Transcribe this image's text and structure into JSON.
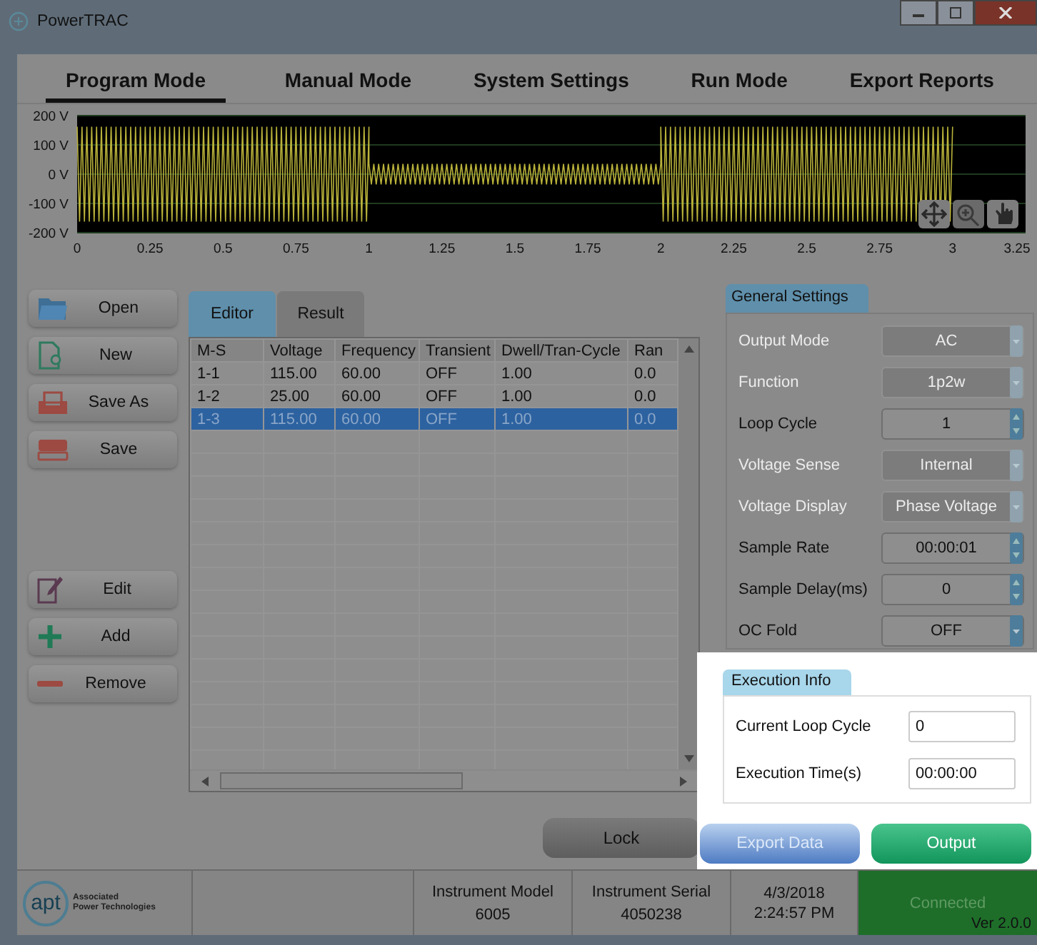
{
  "window": {
    "title": "PowerTRAC"
  },
  "tabs": [
    {
      "label": "Program Mode",
      "selected": true
    },
    {
      "label": "Manual Mode",
      "selected": false
    },
    {
      "label": "System Settings",
      "selected": false
    },
    {
      "label": "Run Mode",
      "selected": false
    },
    {
      "label": "Export Reports",
      "selected": false
    }
  ],
  "waveform": {
    "y_labels": [
      "200 V",
      "100 V",
      "0 V",
      "-100 V",
      "-200 V"
    ],
    "x_labels": [
      "0",
      "0.25",
      "0.5",
      "0.75",
      "1",
      "1.25",
      "1.5",
      "1.75",
      "2",
      "2.25",
      "2.5",
      "2.75",
      "3",
      "3.25"
    ]
  },
  "file_buttons": [
    "Open",
    "New",
    "Save As",
    "Save"
  ],
  "step_buttons": [
    "Edit",
    "Add",
    "Remove"
  ],
  "table_tabs": [
    {
      "label": "Editor",
      "selected": true
    },
    {
      "label": "Result",
      "selected": false
    }
  ],
  "table": {
    "columns": [
      "M-S",
      "Voltage",
      "Frequency",
      "Transient",
      "Dwell/Tran-Cycle",
      "Ran"
    ],
    "rows": [
      {
        "cells": [
          "1-1",
          "115.00",
          "60.00",
          "OFF",
          "1.00",
          "0.0"
        ],
        "selected": false
      },
      {
        "cells": [
          "1-2",
          "25.00",
          "60.00",
          "OFF",
          "1.00",
          "0.0"
        ],
        "selected": false
      },
      {
        "cells": [
          "1-3",
          "115.00",
          "60.00",
          "OFF",
          "1.00",
          "0.0"
        ],
        "selected": true
      }
    ]
  },
  "lock_button": "Lock",
  "general_settings": {
    "title": "General Settings",
    "fields": [
      {
        "label": "Output Mode",
        "value": "AC",
        "kind": "dropdown",
        "disabled": true
      },
      {
        "label": "Function",
        "value": "1p2w",
        "kind": "dropdown",
        "disabled": true
      },
      {
        "label": "Loop Cycle",
        "value": "1",
        "kind": "spinner",
        "disabled": false
      },
      {
        "label": "Voltage Sense",
        "value": "Internal",
        "kind": "dropdown",
        "disabled": true
      },
      {
        "label": "Voltage Display",
        "value": "Phase Voltage",
        "kind": "dropdown",
        "disabled": true
      },
      {
        "label": "Sample Rate",
        "value": "00:00:01",
        "kind": "spinner",
        "disabled": false
      },
      {
        "label": "Sample Delay(ms)",
        "value": "0",
        "kind": "spinner",
        "disabled": false
      },
      {
        "label": "OC Fold",
        "value": "OFF",
        "kind": "dropdown",
        "disabled": false
      }
    ]
  },
  "execution_info": {
    "title": "Execution Info",
    "fields": [
      {
        "label": "Current Loop Cycle",
        "value": "0"
      },
      {
        "label": "Execution Time(s)",
        "value": "00:00:00"
      }
    ]
  },
  "action_buttons": [
    {
      "label": "Export Data",
      "kind": "export",
      "disabled": true
    },
    {
      "label": "Output",
      "kind": "output",
      "disabled": false
    }
  ],
  "status_bar": {
    "logo_mark": "apt",
    "company_lines": [
      "Associated",
      "Power Technologies"
    ],
    "model_label": "Instrument Model",
    "model": "6005",
    "serial_label": "Instrument Serial",
    "serial": "4050238",
    "date": "4/3/2018",
    "time": "2:24:57 PM",
    "connection": "Connected",
    "version": "Ver 2.0.0"
  }
}
